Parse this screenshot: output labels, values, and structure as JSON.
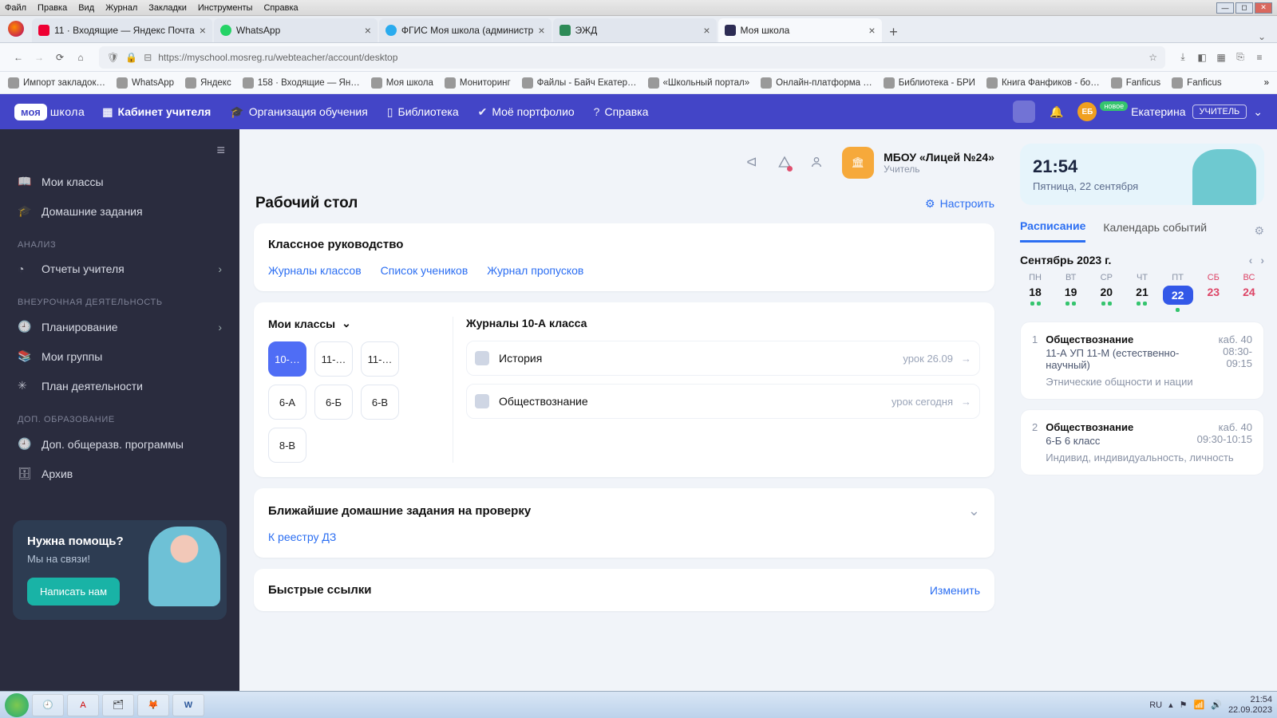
{
  "os_menu": [
    "Файл",
    "Правка",
    "Вид",
    "Журнал",
    "Закладки",
    "Инструменты",
    "Справка"
  ],
  "tabs": [
    {
      "title": "11 · Входящие — Яндекс Почта",
      "favcls": "mail"
    },
    {
      "title": "WhatsApp",
      "favcls": "wa"
    },
    {
      "title": "ФГИС Моя школа (администр",
      "favcls": "tg"
    },
    {
      "title": "ЭЖД",
      "favcls": "ejd"
    },
    {
      "title": "Моя школа",
      "favcls": "ms",
      "active": true
    }
  ],
  "url": "https://myschool.mosreg.ru/webteacher/account/desktop",
  "bookmarks": [
    "Импорт закладок…",
    "WhatsApp",
    "Яндекс",
    "158 · Входящие — Ян…",
    "Моя школа",
    "Мониторинг",
    "Файлы - Байч Екатер…",
    "«Школьный портал»",
    "Онлайн-платформа …",
    "Библиотека - БРИ",
    "Книга Фанфиков - бо…",
    "Fanficus",
    "Fanficus"
  ],
  "topnav": {
    "brand1": "моя",
    "brand2": "школа",
    "links": [
      "Кабинет учителя",
      "Организация обучения",
      "Библиотека",
      "Моё портфолио",
      "Справка"
    ],
    "user": "Екатерина",
    "role": "УЧИТЕЛЬ",
    "new": "новое"
  },
  "sidebar": {
    "groups": [
      {
        "head": null,
        "items": [
          {
            "icon": "📖",
            "label": "Мои классы"
          },
          {
            "icon": "🎓",
            "label": "Домашние задания"
          }
        ]
      },
      {
        "head": "АНАЛИЗ",
        "items": [
          {
            "icon": "◔",
            "label": "Отчеты учителя",
            "chev": true
          }
        ]
      },
      {
        "head": "ВНЕУРОЧНАЯ ДЕЯТЕЛЬНОСТЬ",
        "items": [
          {
            "icon": "🕘",
            "label": "Планирование",
            "chev": true
          },
          {
            "icon": "📚",
            "label": "Мои группы"
          },
          {
            "icon": "✳",
            "label": "План деятельности"
          }
        ]
      },
      {
        "head": "ДОП. ОБРАЗОВАНИЕ",
        "items": [
          {
            "icon": "🕘",
            "label": "Доп. общеразв. программы"
          },
          {
            "icon": "🗄",
            "label": "Архив"
          }
        ]
      }
    ],
    "help": {
      "title": "Нужна помощь?",
      "sub": "Мы на связи!",
      "btn": "Написать нам"
    }
  },
  "school": {
    "name": "МБОУ «Лицей №24»",
    "role": "Учитель"
  },
  "page": {
    "title": "Рабочий стол",
    "configure": "Настроить"
  },
  "classlead": {
    "title": "Классное руководство",
    "links": [
      "Журналы классов",
      "Список учеников",
      "Журнал пропусков"
    ]
  },
  "myclasses": {
    "title": "Мои классы",
    "journals_title": "Журналы 10-А класса",
    "chips": [
      "10-…",
      "11-…",
      "11-…",
      "6-А",
      "6-Б",
      "6-В",
      "8-В"
    ],
    "journals": [
      {
        "name": "История",
        "meta": "урок 26.09"
      },
      {
        "name": "Обществознание",
        "meta": "урок сегодня"
      }
    ]
  },
  "hw": {
    "title": "Ближайшие домашние задания на проверку",
    "link": "К реестру ДЗ"
  },
  "quick": {
    "title": "Быстрые ссылки",
    "edit": "Изменить"
  },
  "aside": {
    "time": "21:54",
    "date": "Пятница, 22 сентября",
    "tab1": "Расписание",
    "tab2": "Календарь событий",
    "month": "Сентябрь 2023 г.",
    "week": [
      {
        "dw": "ПН",
        "dn": "18",
        "dots": 2
      },
      {
        "dw": "ВТ",
        "dn": "19",
        "dots": 2
      },
      {
        "dw": "СР",
        "dn": "20",
        "dots": 2
      },
      {
        "dw": "ЧТ",
        "dn": "21",
        "dots": 2
      },
      {
        "dw": "ПТ",
        "dn": "22",
        "dots": 1,
        "active": true
      },
      {
        "dw": "СБ",
        "dn": "23",
        "we": true
      },
      {
        "dw": "ВС",
        "dn": "24",
        "we": true
      }
    ],
    "lessons": [
      {
        "n": "1",
        "title": "Обществознание",
        "room": "каб. 40",
        "sub": "11-А УП 11-М (естественно-научный)",
        "time": "08:30-09:15",
        "topic": "Этнические общности и нации"
      },
      {
        "n": "2",
        "title": "Обществознание",
        "room": "каб. 40",
        "sub": "6-Б 6 класс",
        "time": "09:30-10:15",
        "topic": "Индивид, индивидуальность, личность"
      }
    ]
  },
  "taskbar": {
    "lang": "RU",
    "time": "21:54",
    "date": "22.09.2023"
  }
}
